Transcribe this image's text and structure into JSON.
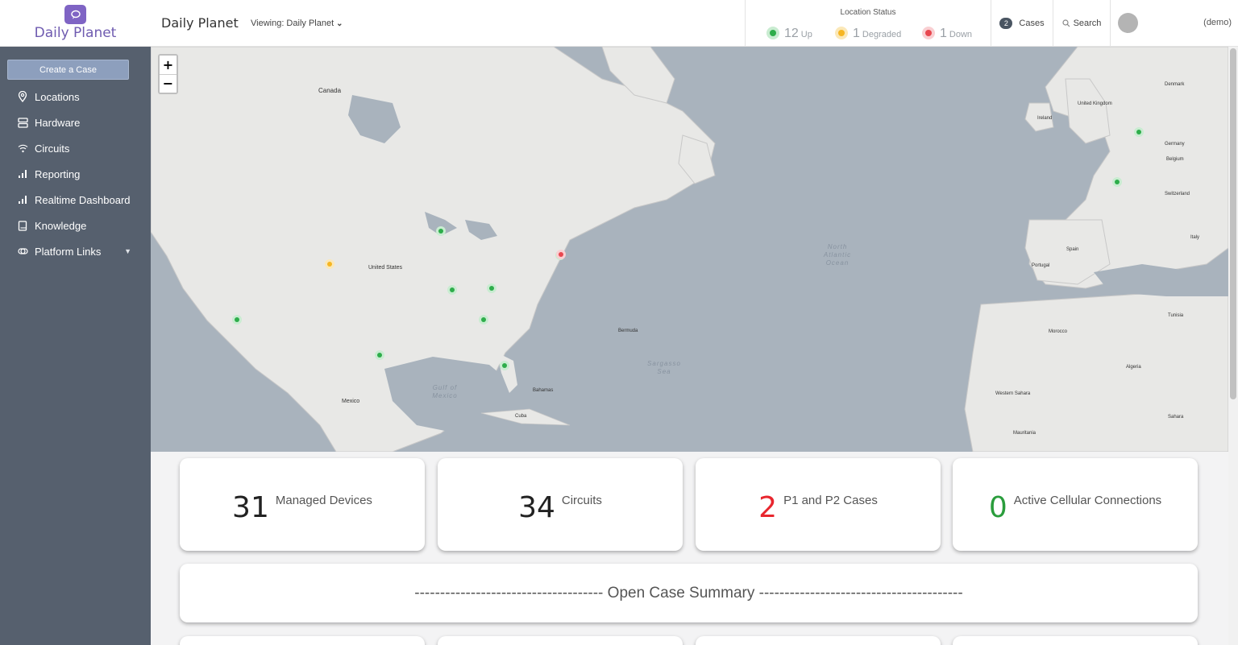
{
  "brand": {
    "name": "Daily Planet"
  },
  "sidebar": {
    "create_label": "Create a Case",
    "items": [
      {
        "label": "Locations",
        "icon": "map-pin-icon"
      },
      {
        "label": "Hardware",
        "icon": "server-icon"
      },
      {
        "label": "Circuits",
        "icon": "wifi-icon"
      },
      {
        "label": "Reporting",
        "icon": "bar-chart-icon"
      },
      {
        "label": "Realtime Dashboard",
        "icon": "bar-chart-icon"
      },
      {
        "label": "Knowledge",
        "icon": "book-icon"
      },
      {
        "label": "Platform Links",
        "icon": "link-icon"
      }
    ]
  },
  "header": {
    "title": "Daily Planet",
    "viewing": "Viewing: Daily Planet",
    "status_title": "Location Status",
    "up_count": "12",
    "up_label": "Up",
    "degraded_count": "1",
    "degraded_label": "Degraded",
    "down_count": "1",
    "down_label": "Down",
    "cases_count": "2",
    "cases_label": "Cases",
    "search_label": "Search",
    "user": "(demo)"
  },
  "map": {
    "zoom_in": "+",
    "zoom_out": "−",
    "labels": {
      "canada": "Canada",
      "united_states": "United States",
      "mexico": "Mexico",
      "cuba": "Cuba",
      "bermuda": "Bermuda",
      "bahamas": "Bahamas",
      "ireland": "Ireland",
      "united_kingdom": "United Kingdom",
      "germany": "Germany",
      "spain": "Spain",
      "portugal": "Portugal",
      "italy": "Italy",
      "morocco": "Morocco",
      "algeria": "Algeria",
      "tunisia": "Tunisia",
      "sahara": "Sahara",
      "mauritania": "Mauritania",
      "western_sahara": "Western Sahara",
      "belgium": "Belgium",
      "switzerland": "Switzerland",
      "denmark": "Denmark",
      "north_atlantic": "North Atlantic Ocean",
      "sargasso": "Sargasso Sea",
      "gulf_mexico": "Gulf of Mexico"
    },
    "markers_status": [
      "up",
      "up",
      "up",
      "up",
      "up",
      "up",
      "up",
      "up",
      "up",
      "up",
      "up",
      "up",
      "degraded",
      "down"
    ]
  },
  "metrics": {
    "managed_devices": {
      "value": "31",
      "label": "Managed Devices"
    },
    "circuits": {
      "value": "34",
      "label": "Circuits"
    },
    "cases": {
      "value": "2",
      "label": "P1 and P2 Cases",
      "color": "#e8262e"
    },
    "cellular": {
      "value": "0",
      "label": "Active Cellular Connections",
      "color": "#2a9d3c"
    }
  },
  "summary": {
    "title": "-------------------------------------  Open Case Summary  ----------------------------------------"
  },
  "colors": {
    "sidebar": "#56606e",
    "brand": "#6f5bb0",
    "up": "#2ead4b",
    "degraded": "#f6b623",
    "down": "#e8474f"
  }
}
